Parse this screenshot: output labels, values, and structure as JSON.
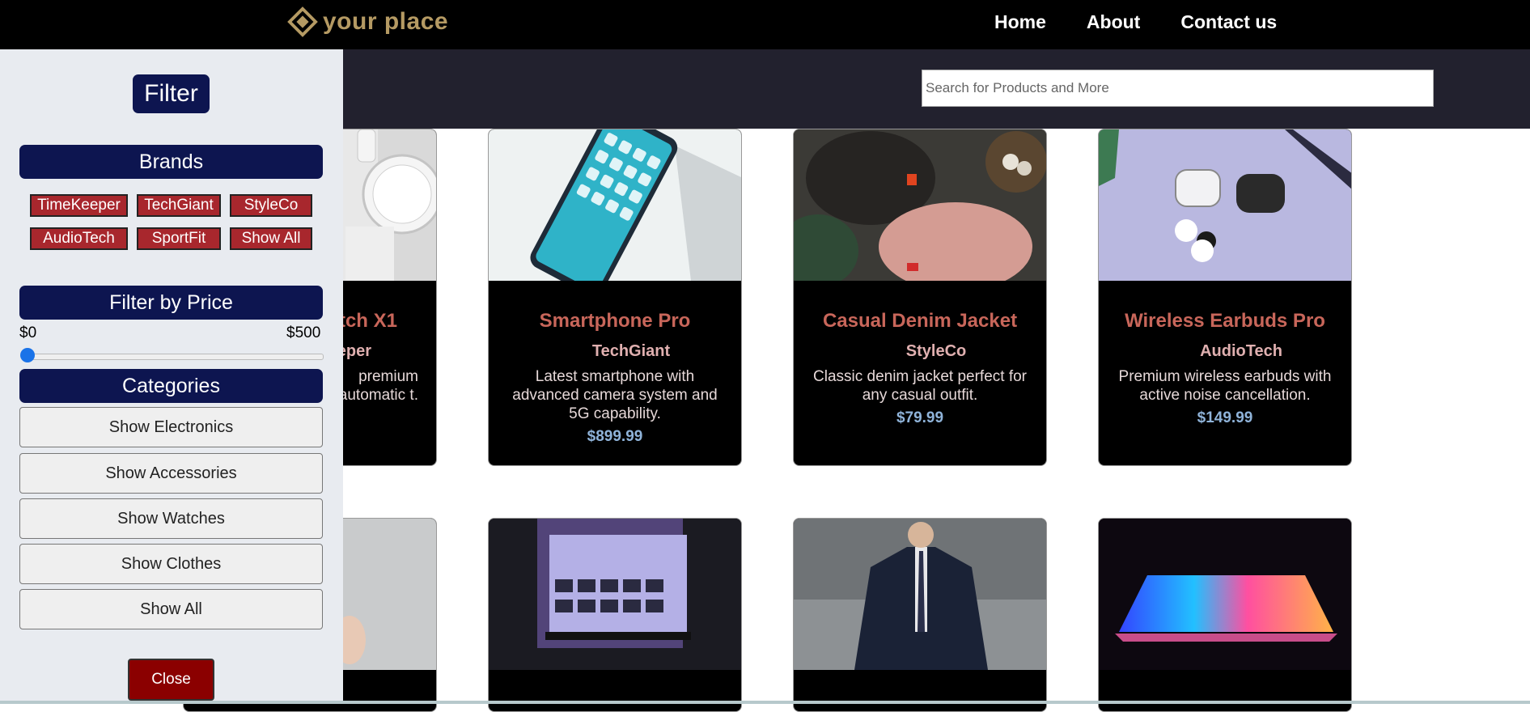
{
  "navbar": {
    "logo_text": "your place",
    "links": [
      "Home",
      "About",
      "Contact us"
    ]
  },
  "search": {
    "placeholder": "Search for Products and More"
  },
  "sidebar": {
    "title": "Filter",
    "brands_heading": "Brands",
    "brands": [
      "TimeKeeper",
      "TechGiant",
      "StyleCo",
      "AudioTech",
      "SportFit",
      "Show All"
    ],
    "price_heading": "Filter by Price",
    "price_min": "$0",
    "price_max": "$500",
    "price_slider_value": 0,
    "categories_heading": "Categories",
    "categories": [
      "Show Electronics",
      "Show Accessories",
      "Show Watches",
      "Show Clothes",
      "Show All"
    ],
    "close_label": "Close"
  },
  "products": [
    {
      "name": "tch X1",
      "brand": "eper",
      "desc": "premium automatic t.",
      "price": ""
    },
    {
      "name": "Smartphone Pro",
      "brand": "TechGiant",
      "desc": "Latest smartphone with advanced camera system and 5G capability.",
      "price": "$899.99"
    },
    {
      "name": "Casual Denim Jacket",
      "brand": "StyleCo",
      "desc": "Classic denim jacket perfect for any casual outfit.",
      "price": "$79.99"
    },
    {
      "name": "Wireless Earbuds Pro",
      "brand": "AudioTech",
      "desc": "Premium wireless earbuds with active noise cancellation.",
      "price": "$149.99"
    }
  ],
  "colors": {
    "navbar": "#000000",
    "search_strip": "#22212e",
    "sidebar_bg": "#e8ebf0",
    "heading_bg": "#0d1550",
    "brand_btn": "#a8272d",
    "close_btn": "#8b0000",
    "product_name": "#c8665a",
    "price": "#8fb3d9",
    "logo": "#b59a63"
  }
}
